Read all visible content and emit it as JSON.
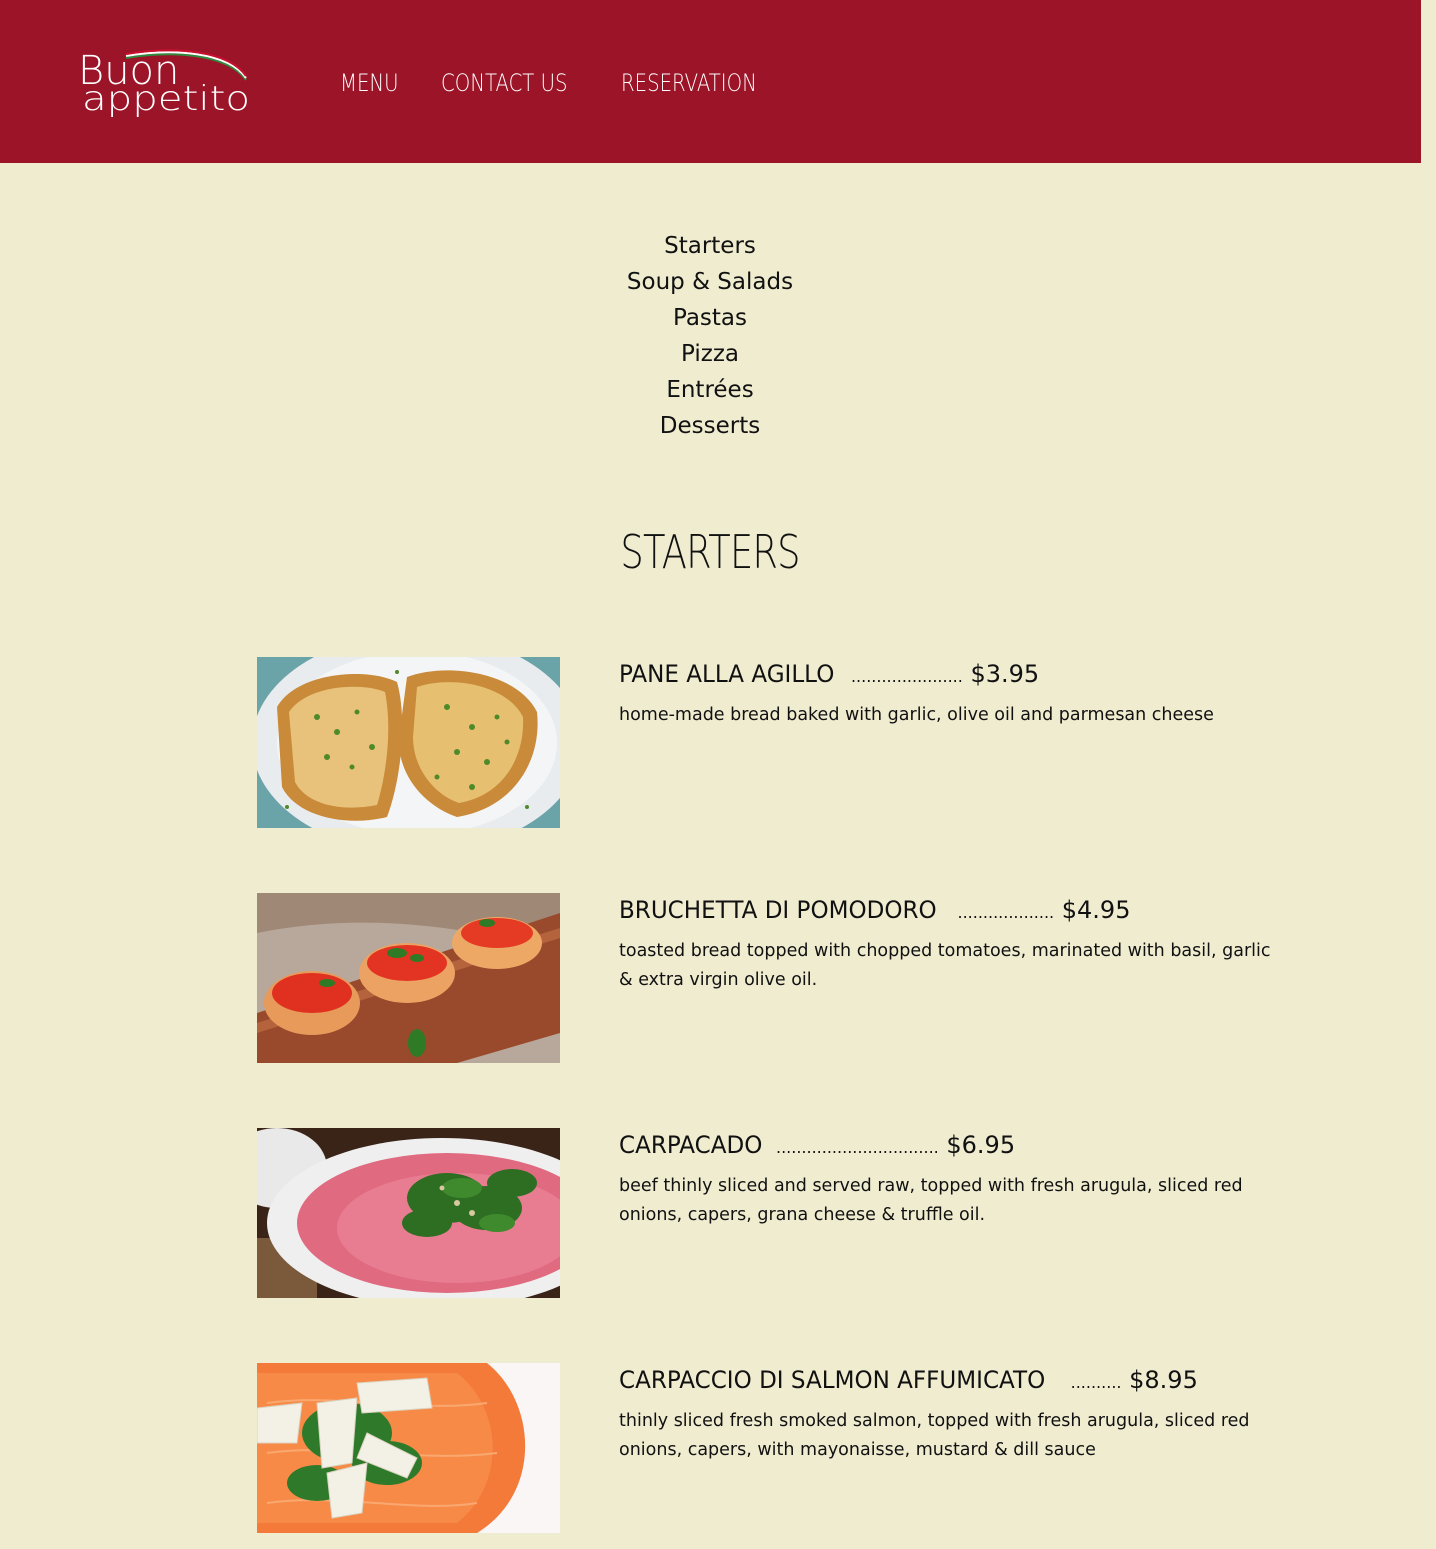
{
  "header": {
    "brand_line1": "Buon",
    "brand_line2": "appetito",
    "nav": [
      "MENU",
      "CONTACT US",
      "RESERVATION"
    ],
    "colors": {
      "background": "#9b1428",
      "text": "#ffffff"
    }
  },
  "categories": [
    "Starters",
    "Soup & Salads",
    "Pastas",
    "Pizza",
    "Entrées",
    "Desserts"
  ],
  "section_title": "STARTERS",
  "items": [
    {
      "name": "PANE ALLA AGILLO",
      "dots": "......................",
      "price": "$3.95",
      "description": "home-made bread baked with garlic, olive oil and parmesan cheese",
      "photo": "garlic-bread-photo"
    },
    {
      "name": "BRUCHETTA DI POMODORO",
      "dots": "...................",
      "price": "$4.95",
      "description": "toasted bread topped with chopped tomatoes, marinated with basil, garlic & extra virgin olive oil.",
      "photo": "bruschetta-photo"
    },
    {
      "name": "CARPACADO",
      "dots": "................................",
      "price": "$6.95",
      "description": "beef thinly sliced and served raw, topped with fresh arugula, sliced red onions, capers, grana cheese & truffle oil.",
      "photo": "beef-carpaccio-photo"
    },
    {
      "name": "CARPACCIO DI SALMON AFFUMICATO",
      "dots": "..........",
      "price": "$8.95",
      "description": "thinly sliced fresh smoked salmon, topped with fresh arugula, sliced red onions, capers, with mayonaisse, mustard & dill sauce",
      "photo": "salmon-carpaccio-photo"
    }
  ],
  "page_colors": {
    "background": "#efecd0",
    "text": "#111111"
  }
}
